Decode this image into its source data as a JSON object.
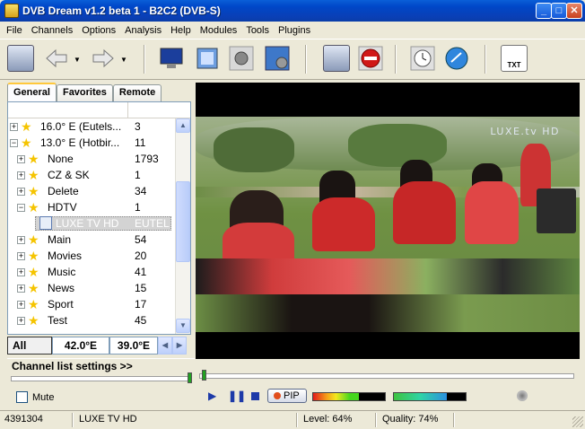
{
  "window": {
    "title": "DVB Dream v1.2 beta 1 - B2C2 (DVB-S)",
    "controls": {
      "minimize": "_",
      "maximize": "□",
      "close": "✕"
    }
  },
  "menu": [
    "File",
    "Channels",
    "Options",
    "Analysis",
    "Help",
    "Modules",
    "Tools",
    "Plugins"
  ],
  "toolbar": {
    "icons": [
      "record-video-icon",
      "back-arrow-icon",
      "forward-arrow-icon",
      "monitor-icon",
      "window-icon",
      "settings-gear-icon",
      "screenshot-settings-icon",
      "record-icon",
      "stop-sign-icon",
      "clock-timer-icon",
      "globe-icon",
      "txt-teletext-icon"
    ],
    "txt_label": "TXT"
  },
  "tabs": [
    "General",
    "Favorites",
    "Remote"
  ],
  "channel_tree": [
    {
      "indent": 0,
      "expander": "+",
      "name": "16.0° E (Eutels...",
      "count": "3"
    },
    {
      "indent": 0,
      "expander": "−",
      "name": "13.0° E (Hotbir...",
      "count": "11"
    },
    {
      "indent": 1,
      "expander": "+",
      "name": "None",
      "count": "1793"
    },
    {
      "indent": 1,
      "expander": "+",
      "name": "CZ & SK",
      "count": "1"
    },
    {
      "indent": 1,
      "expander": "+",
      "name": "Delete",
      "count": "34"
    },
    {
      "indent": 1,
      "expander": "−",
      "name": "HDTV",
      "count": "1"
    },
    {
      "indent": 2,
      "expander": "",
      "name": "LUXE TV HD",
      "count": "EUTEL",
      "selected": true
    },
    {
      "indent": 1,
      "expander": "+",
      "name": "Main",
      "count": "54"
    },
    {
      "indent": 1,
      "expander": "+",
      "name": "Movies",
      "count": "20"
    },
    {
      "indent": 1,
      "expander": "+",
      "name": "Music",
      "count": "41"
    },
    {
      "indent": 1,
      "expander": "+",
      "name": "News",
      "count": "15"
    },
    {
      "indent": 1,
      "expander": "+",
      "name": "Sport",
      "count": "17"
    },
    {
      "indent": 1,
      "expander": "+",
      "name": "Test",
      "count": "45"
    }
  ],
  "satellite_bar": {
    "all": "All",
    "sat1": "42.0°E",
    "sat2": "39.0°E"
  },
  "channel_list_settings": "Channel list settings >>",
  "mute_label": "Mute",
  "video": {
    "logo": "LUXE.tv HD"
  },
  "controls": {
    "pip_label": "PIP",
    "level_fraction": 0.64,
    "quality_fraction": 0.74
  },
  "status": {
    "id": "4391304",
    "channel": "LUXE TV HD",
    "level": "Level: 64%",
    "quality": "Quality: 74%"
  },
  "colors": {
    "titlebar": "#0a4fd0",
    "selection": "#d3d3d3",
    "star": "#f5c400",
    "accent_red": "#cc2a2a"
  }
}
